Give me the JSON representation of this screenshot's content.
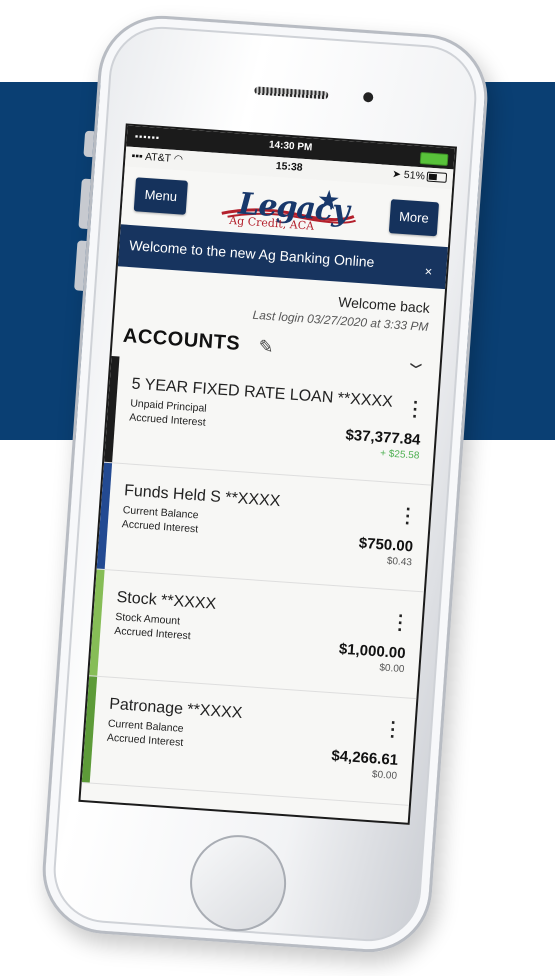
{
  "status_bar": {
    "signal_dots": "▪▪▪▪▪▪",
    "clock_top": "14:30 PM",
    "carrier": "AT&T",
    "clock": "15:38",
    "battery_text": "51%"
  },
  "app_bar": {
    "menu_label": "Menu",
    "more_label": "More",
    "logo_word": "Legacy",
    "logo_sub": "Ag Credit, ACA"
  },
  "banner": {
    "text": "Welcome to the new Ag Banking Online",
    "close": "×"
  },
  "welcome": {
    "greeting": "Welcome back",
    "last_login": "Last login 03/27/2020 at 3:33 PM"
  },
  "accounts": {
    "title": "ACCOUNTS",
    "items": [
      {
        "name": "5 YEAR FIXED RATE LOAN **XXXX",
        "label1": "Unpaid Principal",
        "label2": "Accrued Interest",
        "amount": "$37,377.84",
        "sub_amount": "+ $25.58",
        "color": "#1c1c1c"
      },
      {
        "name": "Funds Held S **XXXX",
        "label1": "Current Balance",
        "label2": "Accrued Interest",
        "amount": "$750.00",
        "sub_amount": "$0.43",
        "color": "#234a92"
      },
      {
        "name": "Stock **XXXX",
        "label1": "Stock Amount",
        "label2": "Accrued Interest",
        "amount": "$1,000.00",
        "sub_amount": "$0.00",
        "color": "#86bd56"
      },
      {
        "name": "Patronage **XXXX",
        "label1": "Current Balance",
        "label2": "Accrued Interest",
        "amount": "$4,266.61",
        "sub_amount": "$0.00",
        "color": "#5d9b38"
      }
    ]
  },
  "colors": {
    "band": "#0a3f73",
    "nav_button": "#15325c",
    "banner": "#17345f",
    "positive": "#4caf50"
  }
}
